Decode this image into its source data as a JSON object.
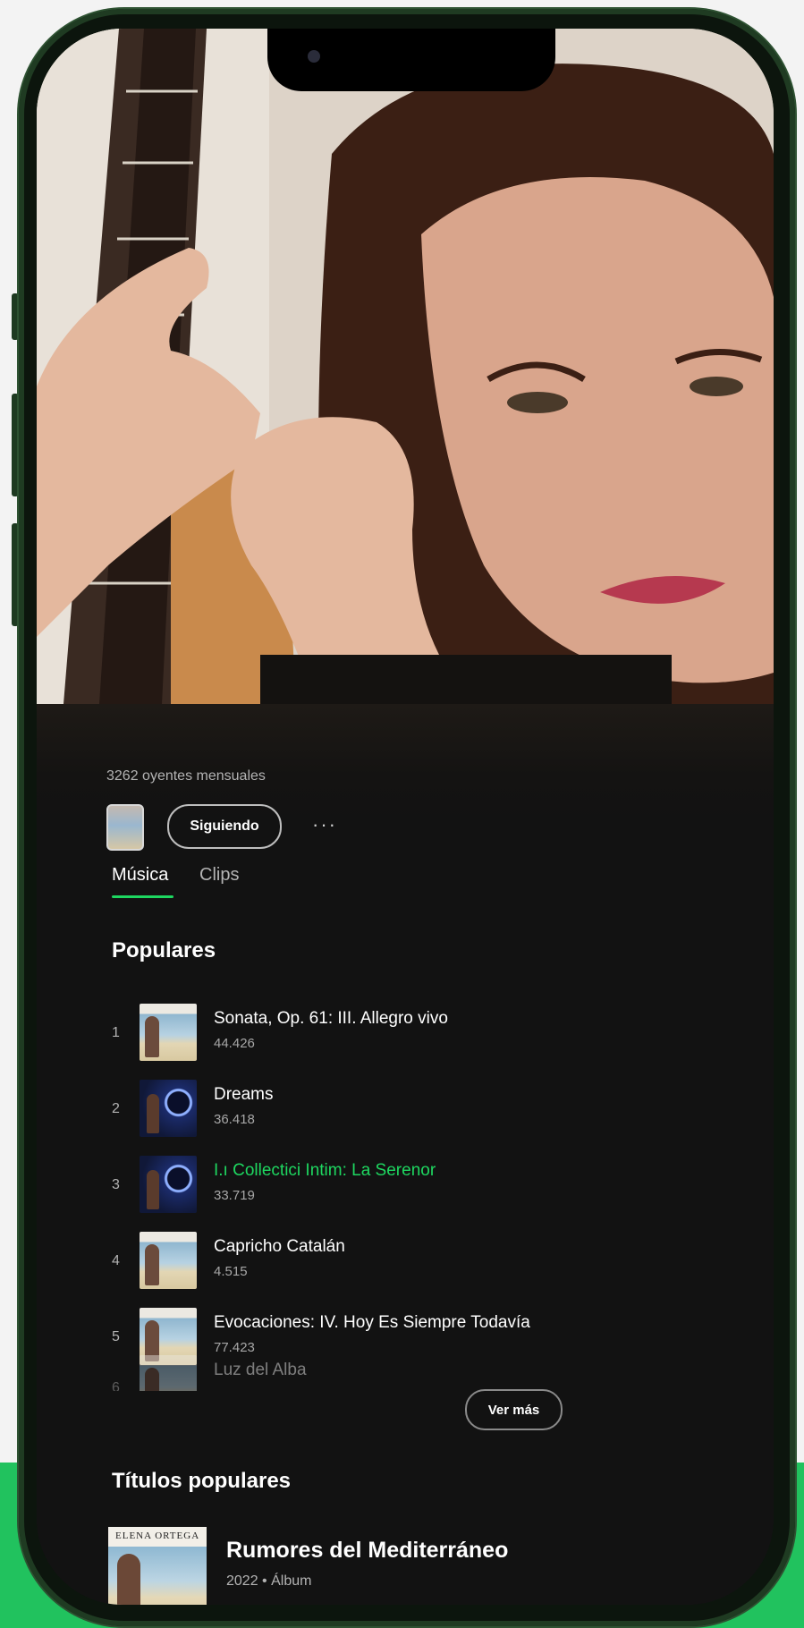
{
  "artist": {
    "monthly_listeners": "3262 oyentes mensuales",
    "follow_label": "Siguiendo",
    "more_label": "···"
  },
  "tabs": [
    {
      "label": "Música",
      "active": true
    },
    {
      "label": "Clips",
      "active": false
    }
  ],
  "popular": {
    "title": "Populares",
    "tracks": [
      {
        "index": "1",
        "title": "Sonata, Op. 61: III. Allegro vivo",
        "plays": "44.426",
        "art": "beach"
      },
      {
        "index": "2",
        "title": "Dreams",
        "plays": "36.418",
        "art": "night"
      },
      {
        "index": "3",
        "title": "I.ı Collectici Intim: La Serenor",
        "plays": "33.719",
        "art": "night",
        "playing": true
      },
      {
        "index": "4",
        "title": "Capricho Catalán",
        "plays": "4.515",
        "art": "beach"
      },
      {
        "index": "5",
        "title": "Evocaciones: IV. Hoy Es Siempre Todavía",
        "plays": "77.423",
        "art": "beach"
      },
      {
        "index": "6",
        "title": "Luz del Alba",
        "plays": "",
        "art": "beach"
      }
    ],
    "see_more_label": "Ver más"
  },
  "popular_releases": {
    "title": "Títulos populares",
    "items": [
      {
        "art_caption": "ELENA ORTEGA",
        "title": "Rumores del Mediterráneo",
        "meta": "2022 • Álbum"
      }
    ]
  },
  "colors": {
    "accent_green": "#1ed760",
    "background": "#121212",
    "brand_band": "#21c25e"
  },
  "icons": [
    "camera-icon",
    "more-options-icon"
  ]
}
